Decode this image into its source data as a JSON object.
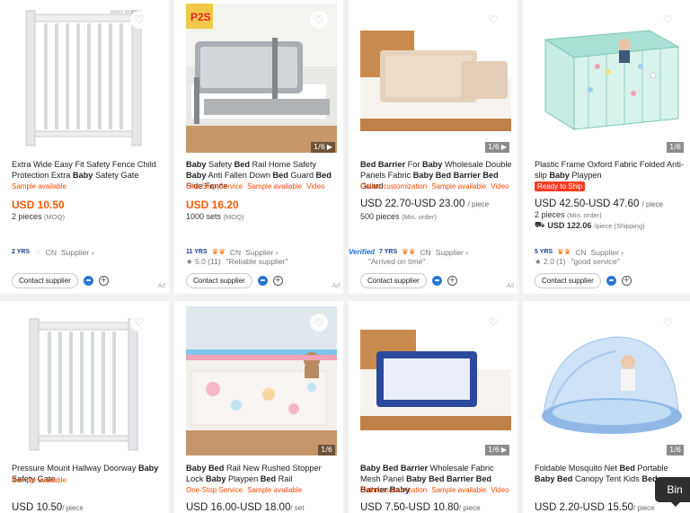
{
  "common": {
    "contact": "Contact supplier",
    "ad": "Ad",
    "heart": "♡",
    "play": "▶",
    "cn": "CN",
    "supplier": "Supplier ›"
  },
  "cards": [
    {
      "title_parts": [
        [
          "Extra Wide Easy Fit Safety Fence Child Protection Extra ",
          false
        ],
        [
          "Baby",
          true
        ],
        [
          " Safety Gate",
          false
        ]
      ],
      "tags": [
        "Sample available"
      ],
      "price": "USD 10.50",
      "moq": "2 pieces",
      "moq_note": "(MOQ)",
      "yrs": "2 YRS",
      "brand_text": "MARS BABY"
    },
    {
      "title_parts": [
        [
          "Baby",
          true
        ],
        [
          " Safety ",
          false
        ],
        [
          "Bed",
          true
        ],
        [
          " Rail Home Safety ",
          false
        ],
        [
          "Baby",
          true
        ],
        [
          " Anti Fallen Down ",
          false
        ],
        [
          "Bed",
          true
        ],
        [
          " Guard ",
          false
        ],
        [
          "Bed",
          true
        ],
        [
          " Side Fence",
          false
        ]
      ],
      "tags": [
        "One-Stop Service",
        "Sample available",
        "Video"
      ],
      "price": "USD 16.20",
      "moq": "1000 sets",
      "moq_note": "(MOQ)",
      "yrs": "11 YRS",
      "rating": "★ 5.0 (11)",
      "review": "\"Reliable supplier\"",
      "count": "1/6",
      "brand_text": "P2S"
    },
    {
      "title_parts": [
        [
          "Bed Barrier",
          true
        ],
        [
          " For ",
          false
        ],
        [
          "Baby",
          true
        ],
        [
          " Wholesale Double Panels Fabric ",
          false
        ],
        [
          "Baby Bed Barrier Bed",
          true
        ],
        [
          " Guard",
          false
        ]
      ],
      "tags": [
        "Online customization",
        "Sample available",
        "Video"
      ],
      "price": "USD 22.70-USD 23.00",
      "price_unit": "/ piece",
      "moq": "500 pieces",
      "moq_note": "(Min. order)",
      "verified": "Verified",
      "yrs": "7 YRS",
      "review": "\"Arrived on time\"",
      "count": "1/6"
    },
    {
      "title_parts": [
        [
          "Plastic Frame Oxford Fabric Folded Anti-slip ",
          false
        ],
        [
          "Baby",
          true
        ],
        [
          " Playpen",
          false
        ]
      ],
      "tags": [
        "Ready to Ship"
      ],
      "price": "USD 42.50-USD 47.60",
      "price_unit": "/ piece",
      "moq": "2 pieces",
      "moq_note": "(Min. order)",
      "ship_price": "USD 122.06",
      "ship_note": "/piece (Shipping)",
      "yrs": "5 YRS",
      "rating": "★ 2.0 (1)",
      "review": "\"good service\"",
      "count": "1/6"
    },
    {
      "title_parts": [
        [
          "Pressure Mount Hallway Doorway ",
          false
        ],
        [
          "Baby",
          true
        ],
        [
          " Safety Gate",
          false
        ]
      ],
      "tags": [
        "Sample available"
      ],
      "price": "USD 10.50",
      "price_unit": "/ piece"
    },
    {
      "title_parts": [
        [
          "Baby Bed",
          true
        ],
        [
          " Rail New Rushed Stopper Lock ",
          false
        ],
        [
          "Baby",
          true
        ],
        [
          " Playpen ",
          false
        ],
        [
          "Bed",
          true
        ],
        [
          " Rail",
          false
        ]
      ],
      "tags": [
        "One-Stop Service",
        "Sample available"
      ],
      "price": "USD 16.00-USD 18.00",
      "price_unit": "/ set",
      "count": "1/6"
    },
    {
      "title_parts": [
        [
          "Baby Bed Barrier",
          true
        ],
        [
          " Wholesale Fabric Mesh Panel ",
          false
        ],
        [
          "Baby Bed Barrier Bed Barrier Baby",
          true
        ]
      ],
      "tags": [
        "Online customization",
        "Sample available",
        "Video"
      ],
      "price": "USD 7.50-USD 10.80",
      "price_unit": "/ piece",
      "count": "1/6"
    },
    {
      "title_parts": [
        [
          "Foldable Mosquito Net ",
          false
        ],
        [
          "Bed",
          true
        ],
        [
          " Portable ",
          false
        ],
        [
          "Baby Bed",
          true
        ],
        [
          " Canopy Tent Kids ",
          false
        ],
        [
          "Bed",
          true
        ]
      ],
      "tags": [],
      "price": "USD 2.20-USD 15.50",
      "price_unit": "/ piece",
      "count": "1/6"
    }
  ],
  "bin": "Bin",
  "colors": {
    "orange": "#ff5a00",
    "tag_red": "#ff3b1f",
    "gate": "#eef0f2",
    "rail_gray": "#9a9ea3",
    "rail_tan": "#e8d6c2",
    "wood": "#c9894a",
    "blue": "#2c4a9c",
    "mint": "#8fd6c6",
    "net_blue": "#bcd6f0"
  }
}
